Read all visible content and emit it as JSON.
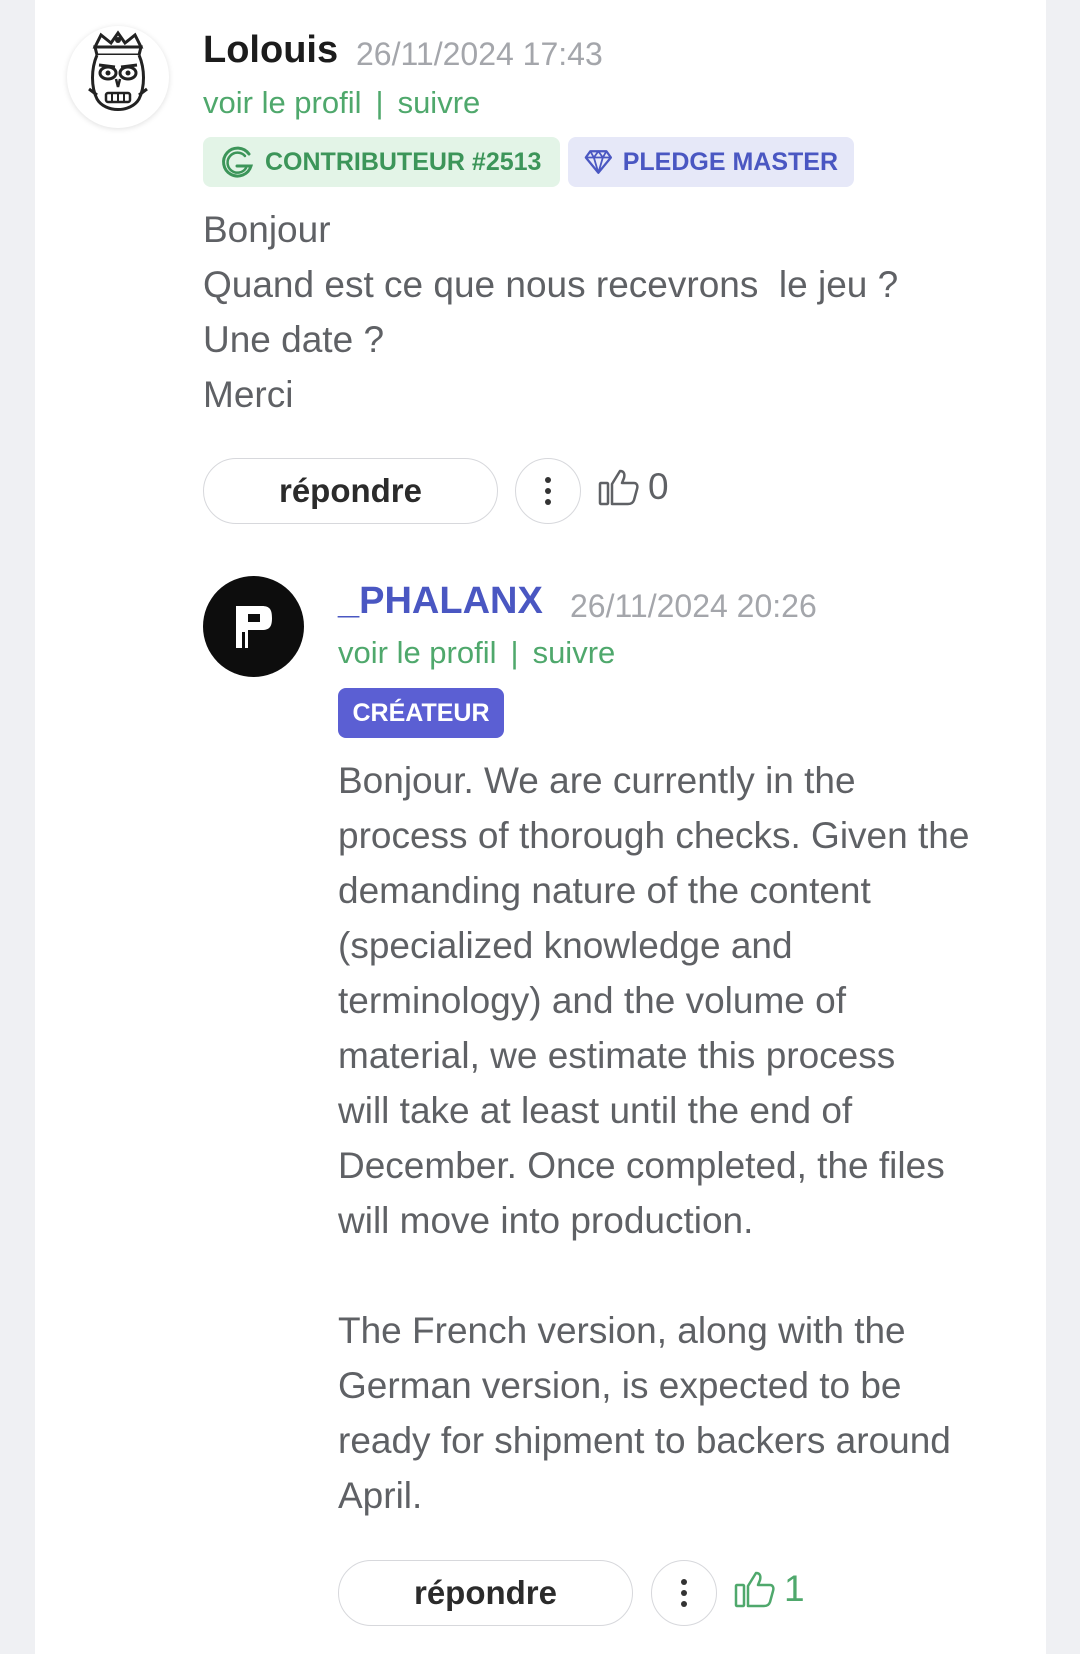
{
  "comment": {
    "username": "Lolouis",
    "timestamp": "26/11/2024 17:43",
    "profile_link": "voir le profil",
    "separator": "|",
    "follow_link": "suivre",
    "badges": [
      {
        "label": "CONTRIBUTEUR #2513",
        "icon": "contributor-g-icon"
      },
      {
        "label": "PLEDGE MASTER",
        "icon": "diamond-icon"
      }
    ],
    "text": "Bonjour\nQuand est ce que nous recevrons  le jeu ?\nUne date ?\nMerci",
    "reply_label": "répondre",
    "like_count": "0"
  },
  "reply": {
    "username": "_PHALANX",
    "timestamp": "26/11/2024 20:26",
    "profile_link": "voir le profil",
    "separator": "|",
    "follow_link": "suivre",
    "badge": "CRÉATEUR",
    "avatar_letter": "P",
    "text": "Bonjour. We are currently in the\nprocess of thorough checks. Given the\ndemanding nature of the content\n(specialized knowledge and\nterminology) and the volume of\nmaterial, we estimate this process\nwill take at least until the end of\nDecember. Once completed, the files\nwill move into production.\n\nThe French version, along with the\nGerman version, is expected to be\nready for shipment to backers around\nApril.",
    "reply_label": "répondre",
    "like_count": "1"
  },
  "colors": {
    "link_green": "#4fa86c",
    "creator_badge": "#5b5fd3",
    "like_active": "#4fa86c",
    "like_inactive": "#5f6165"
  }
}
